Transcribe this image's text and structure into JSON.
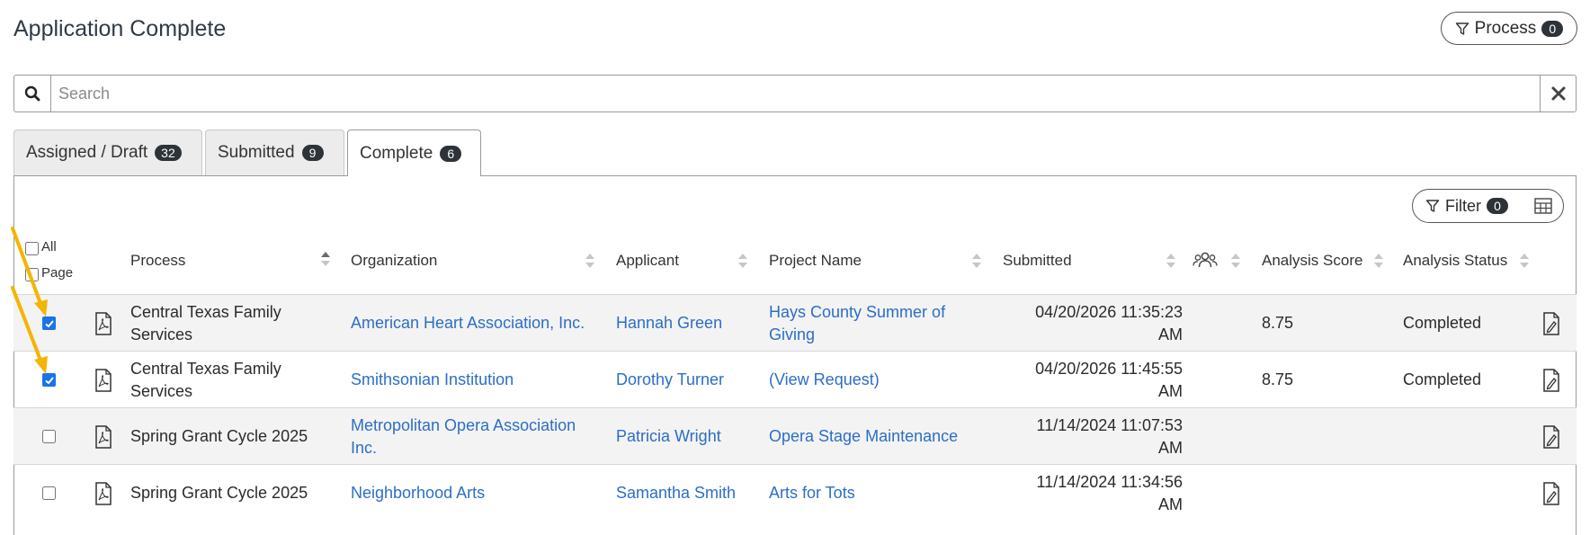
{
  "page": {
    "title": "Application Complete"
  },
  "process_button": {
    "label": "Process",
    "count": "0"
  },
  "search": {
    "placeholder": "Search"
  },
  "tabs": [
    {
      "label": "Assigned / Draft",
      "count": "32"
    },
    {
      "label": "Submitted",
      "count": "9"
    },
    {
      "label": "Complete",
      "count": "6"
    }
  ],
  "filter_button": {
    "label": "Filter",
    "count": "0"
  },
  "select": {
    "all_label": "All",
    "page_label": "Page"
  },
  "columns": {
    "process": "Process",
    "organization": "Organization",
    "applicant": "Applicant",
    "project_name": "Project Name",
    "submitted": "Submitted",
    "analysis_score": "Analysis Score",
    "analysis_status": "Analysis Status"
  },
  "rows": [
    {
      "checked": true,
      "process_l1": "Central Texas Family",
      "process_l2": "Services",
      "org_l1": "American Heart Association, Inc.",
      "org_l2": "",
      "applicant": "Hannah Green",
      "project_l1": "Hays County Summer of",
      "project_l2": "Giving",
      "submitted_l1": "04/20/2026 11:35:23",
      "submitted_l2": "AM",
      "score": "8.75",
      "status": "Completed"
    },
    {
      "checked": true,
      "process_l1": "Central Texas Family",
      "process_l2": "Services",
      "org_l1": "Smithsonian Institution",
      "org_l2": "",
      "applicant": "Dorothy Turner",
      "project_l1": "(View Request)",
      "project_l2": "",
      "submitted_l1": "04/20/2026 11:45:55",
      "submitted_l2": "AM",
      "score": "8.75",
      "status": "Completed"
    },
    {
      "checked": false,
      "process_l1": "Spring Grant Cycle 2025",
      "process_l2": "",
      "org_l1": "Metropolitan Opera Association",
      "org_l2": "Inc.",
      "applicant": "Patricia Wright",
      "project_l1": "Opera Stage Maintenance",
      "project_l2": "",
      "submitted_l1": "11/14/2024 11:07:53",
      "submitted_l2": "AM",
      "score": "",
      "status": ""
    },
    {
      "checked": false,
      "process_l1": "Spring Grant Cycle 2025",
      "process_l2": "",
      "org_l1": "Neighborhood Arts",
      "org_l2": "",
      "applicant": "Samantha Smith",
      "project_l1": "Arts for Tots",
      "project_l2": "",
      "submitted_l1": "11/14/2024 11:34:56",
      "submitted_l2": "AM",
      "score": "",
      "status": ""
    }
  ],
  "colors": {
    "link": "#2c6ec6",
    "badge": "#2d3338",
    "checkbox": "#1a73e8",
    "annotation_arrow": "#f5b400"
  }
}
